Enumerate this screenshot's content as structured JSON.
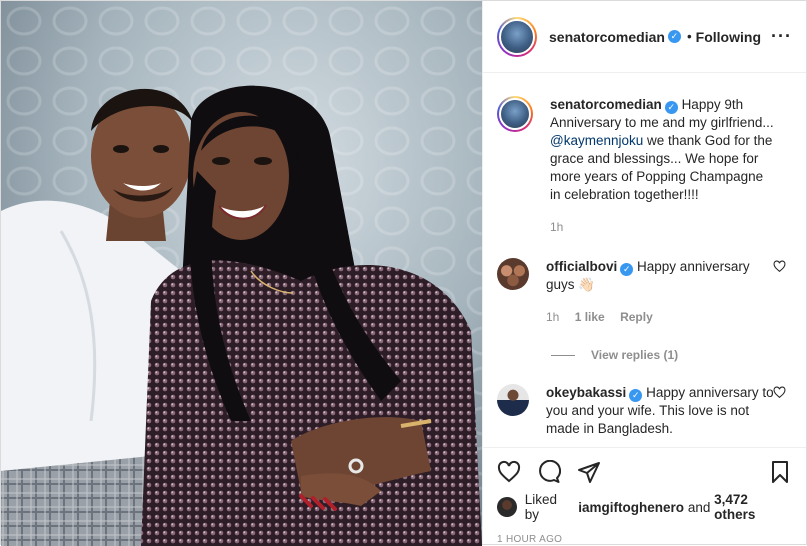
{
  "post": {
    "username": "senatorcomedian",
    "follow_status": "Following",
    "more_icon": "more-options-icon",
    "caption": {
      "username": "senatorcomedian",
      "text_before": "Happy 9th Anniversary to me and my girlfriend...",
      "mention": "@kaymennjoku",
      "text_after": "we thank God for the grace and blessings... We hope for more years of Popping Champagne in celebration together!!!!",
      "time": "1h"
    },
    "comments": [
      {
        "username": "officialbovi",
        "text": "Happy anniversary guys 👋🏻",
        "time": "1h",
        "likes": "1 like",
        "reply_label": "Reply",
        "view_replies": "View replies (1)"
      },
      {
        "username": "okeybakassi",
        "text": "Happy anniversary to you and your wife. This love is not made in Bangladesh."
      }
    ],
    "likes": {
      "prefix": "Liked by",
      "user": "iamgiftoghenero",
      "conj": "and",
      "others": "3,472 others"
    },
    "timestamp": "1 HOUR AGO"
  },
  "colors": {
    "verified": "#3897f0",
    "muted": "#8e8e8e",
    "mention": "#00376b",
    "border": "#dbdbdb"
  }
}
